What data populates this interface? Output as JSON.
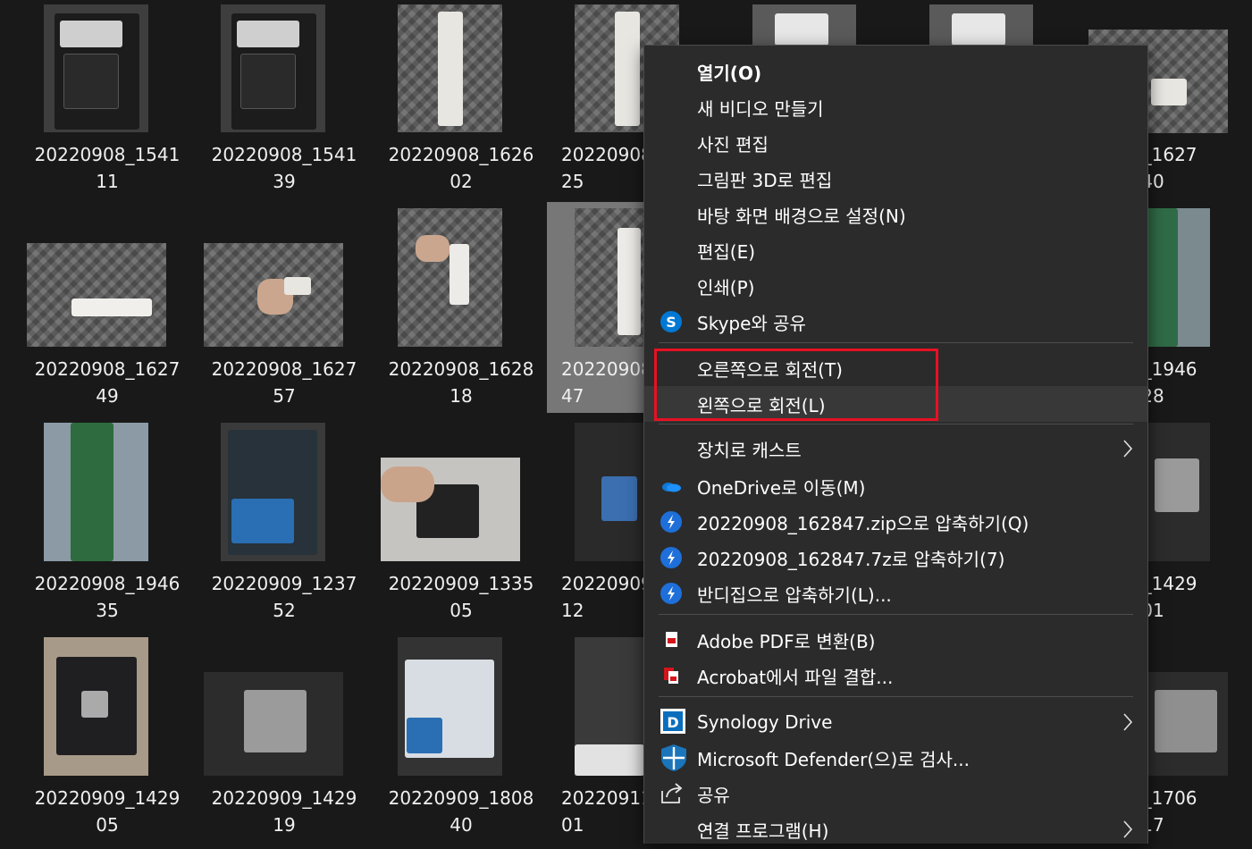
{
  "files": [
    {
      "name": "20220908_1541\n11"
    },
    {
      "name": "20220908_1541\n39"
    },
    {
      "name": "20220908_1626\n02"
    },
    {
      "name": "20220908\n25"
    },
    {
      "name": "908_1627\n40"
    },
    {
      "name": "20220908_1627\n49"
    },
    {
      "name": "20220908_1627\n57"
    },
    {
      "name": "20220908_1628\n18"
    },
    {
      "name": "20220908\n47"
    },
    {
      "name": "908_1946\n28"
    },
    {
      "name": "20220908_1946\n35"
    },
    {
      "name": "20220909_1237\n52"
    },
    {
      "name": "20220909_1335\n05"
    },
    {
      "name": "20220909\n12"
    },
    {
      "name": "909_1429\n01"
    },
    {
      "name": "20220909_1429\n05"
    },
    {
      "name": "20220909_1429\n19"
    },
    {
      "name": "20220909_1808\n40"
    },
    {
      "name": "20220911\n01"
    },
    {
      "name": "911_1706\n17"
    }
  ],
  "context_menu": {
    "open": "열기(O)",
    "new_video": "새 비디오 만들기",
    "edit_photo": "사진 편집",
    "edit_paint3d": "그림판 3D로 편집",
    "set_wallpaper": "바탕 화면 배경으로 설정(N)",
    "edit": "편집(E)",
    "print": "인쇄(P)",
    "share_skype": "Skype와 공유",
    "rotate_right": "오른쪽으로 회전(T)",
    "rotate_left": "왼쪽으로 회전(L)",
    "cast": "장치로 캐스트",
    "onedrive": "OneDrive로 이동(M)",
    "zip": "20220908_162847.zip으로 압축하기(Q)",
    "sevenz": "20220908_162847.7z로 압축하기(7)",
    "bandizip": "반디집으로 압축하기(L)...",
    "adobe_pdf": "Adobe PDF로 변환(B)",
    "acrobat_combine": "Acrobat에서 파일 결합...",
    "synology": "Synology Drive",
    "defender": "Microsoft Defender(으)로 검사...",
    "share": "공유",
    "open_with": "연결 프로그램(H)"
  },
  "colors": {
    "background": "#191919",
    "menu_bg": "#2b2b2b",
    "highlight_box": "#e81123",
    "skype": "#0078d4",
    "onedrive": "#0f78d4",
    "bandizip": "#1e6fd9",
    "adobe": "#d4151b",
    "synology": "#0a6ebd",
    "defender": "#1b75bb"
  }
}
